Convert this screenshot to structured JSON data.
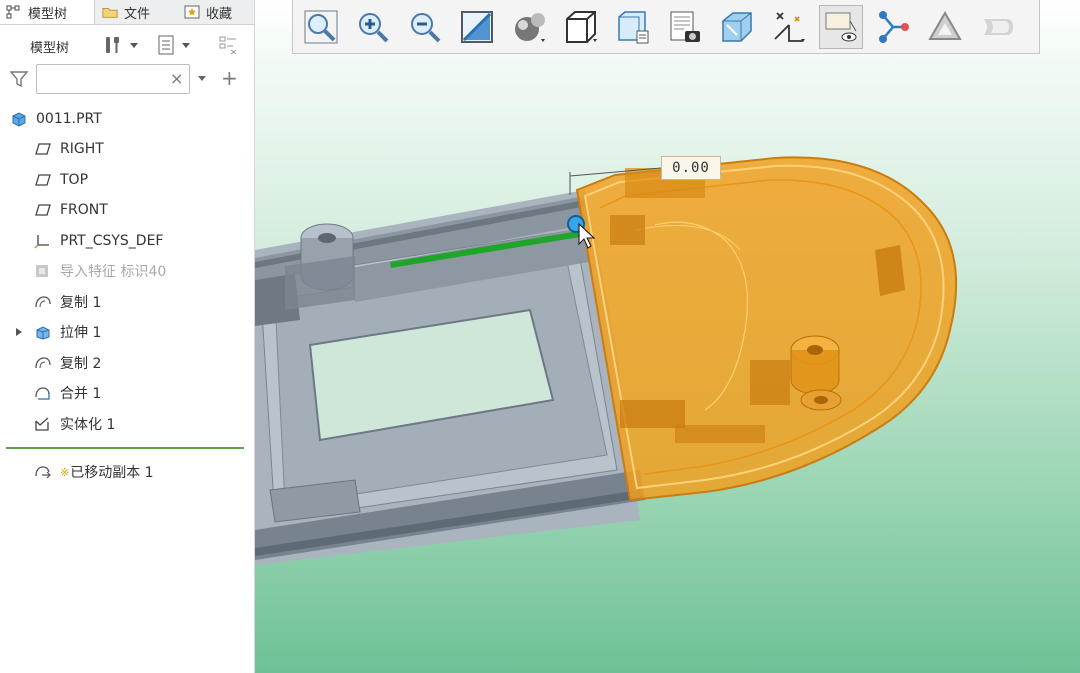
{
  "tabs": [
    {
      "label": "模型树",
      "icon": "model-tree-icon",
      "active": true
    },
    {
      "label": "文件",
      "icon": "folder-icon",
      "active": false
    },
    {
      "label": "收藏",
      "icon": "favorites-icon",
      "active": false
    }
  ],
  "tree_header": {
    "title": "模型树",
    "buttons": [
      "settings-icon",
      "show-icon",
      "filter-settings-icon"
    ]
  },
  "filter": {
    "value": "",
    "clear_symbol": "×",
    "add_symbol": "+"
  },
  "tree": [
    {
      "label": "0011.PRT",
      "icon": "part-icon",
      "expand": false,
      "dim": false
    },
    {
      "label": "RIGHT",
      "icon": "datum-plane-icon",
      "expand": false,
      "dim": false
    },
    {
      "label": "TOP",
      "icon": "datum-plane-icon",
      "expand": false,
      "dim": false
    },
    {
      "label": "FRONT",
      "icon": "datum-plane-icon",
      "expand": false,
      "dim": false
    },
    {
      "label": "PRT_CSYS_DEF",
      "icon": "csys-icon",
      "expand": false,
      "dim": false
    },
    {
      "label": "导入特征 标识40",
      "icon": "import-feature-icon",
      "expand": false,
      "dim": true
    },
    {
      "label": "复制 1",
      "icon": "copy-surface-icon",
      "expand": false,
      "dim": false
    },
    {
      "label": "拉伸 1",
      "icon": "extrude-icon",
      "expand": true,
      "dim": false
    },
    {
      "label": "复制 2",
      "icon": "copy-surface-icon",
      "expand": false,
      "dim": false
    },
    {
      "label": "合并 1",
      "icon": "merge-icon",
      "expand": false,
      "dim": false
    },
    {
      "label": "实体化 1",
      "icon": "solidify-icon",
      "expand": false,
      "dim": false
    }
  ],
  "insert_here": {
    "label": "已移动副本 1",
    "icon": "moved-copy-icon",
    "marker": "※"
  },
  "view_toolbar": [
    "zoom-fit-icon",
    "zoom-in-icon",
    "zoom-out-icon",
    "repaint-icon",
    "display-style-icon",
    "saved-orientations-icon",
    "view-manager-icon",
    "perspective-icon",
    "section-icon",
    "datum-display-icon",
    "annotation-display-icon",
    "spin-center-icon",
    "mesh-icon",
    "quilt-icon"
  ],
  "dimension": {
    "value": "0.00"
  },
  "colors": {
    "highlight": "#f0a020",
    "model": "#a9b4bf",
    "edge_select": "#1fa52a",
    "separator": "#5aa44a"
  }
}
